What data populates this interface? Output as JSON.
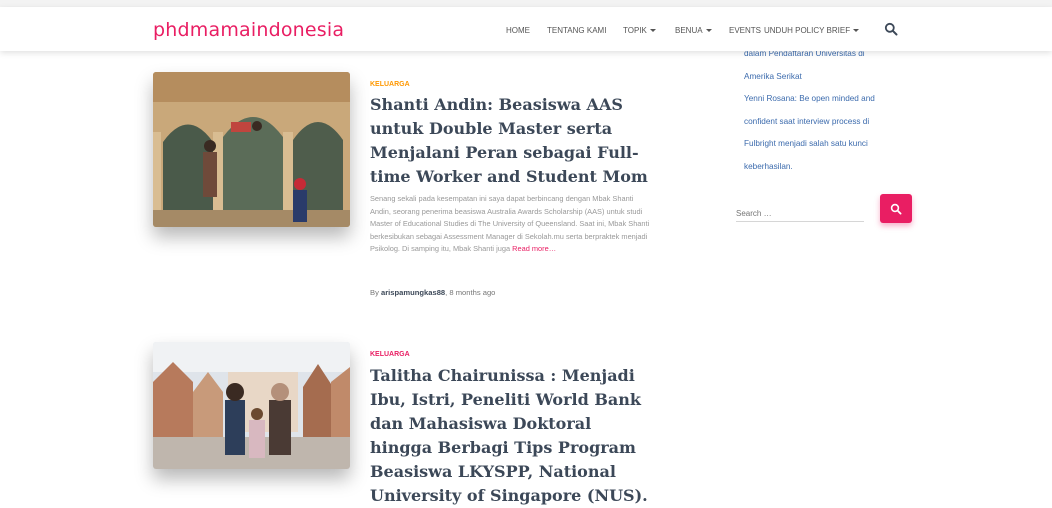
{
  "site": {
    "logo": "phdmamaindonesia"
  },
  "nav": {
    "items": [
      {
        "label": "HOME"
      },
      {
        "label": "TENTANG KAMI"
      },
      {
        "label": "TOPIK"
      },
      {
        "label": "BENUA"
      },
      {
        "label": "EVENTS"
      },
      {
        "label": "UNDUH POLICY BRIEF"
      }
    ]
  },
  "posts": [
    {
      "category": "KELUARGA",
      "category_color": "#ff9800",
      "title": "Shanti Andin: Beasiswa AAS untuk Double Master serta Menjalani Peran sebagai Full-time Worker and Student Mom",
      "excerpt": "Senang sekali pada kesempatan ini saya dapat berbincang dengan Mbak Shanti Andin, seorang penerima beasiswa Australia Awards Scholarship (AAS) untuk studi Master of Educational Studies di The University of Queensland. Saat ini, Mbak Shanti berkesibukan sebagai Assessment Manager di Sekolah.mu serta berpraktek menjadi Psikolog. Di samping itu, Mbak Shanti juga",
      "read_more": "Read more…",
      "by": "By",
      "author": "arispamungkas88",
      "time": ", 8 months ago"
    },
    {
      "category": "KELUARGA",
      "category_color": "#e91e63",
      "title": "Talitha Chairunissa : Menjadi Ibu, Istri, Peneliti World Bank dan Mahasiswa Doktoral hingga Berbagi Tips Program Beasiswa LKYSPP, National University of Singapore (NUS)."
    }
  ],
  "sidebar": {
    "links": [
      "dalam Pendaftaran Universitas di",
      "Amerika Serikat",
      "Yenni Rosana: Be open minded and",
      "confident saat interview process di",
      "Fulbright menjadi salah satu kunci",
      "keberhasilan."
    ],
    "search_placeholder": "Search …"
  },
  "colors": {
    "brand": "#e91e63",
    "link": "#3c6bad",
    "title": "#3c4858"
  },
  "icons": {
    "nav_search": "search-icon",
    "sidebar_search": "search-icon"
  }
}
